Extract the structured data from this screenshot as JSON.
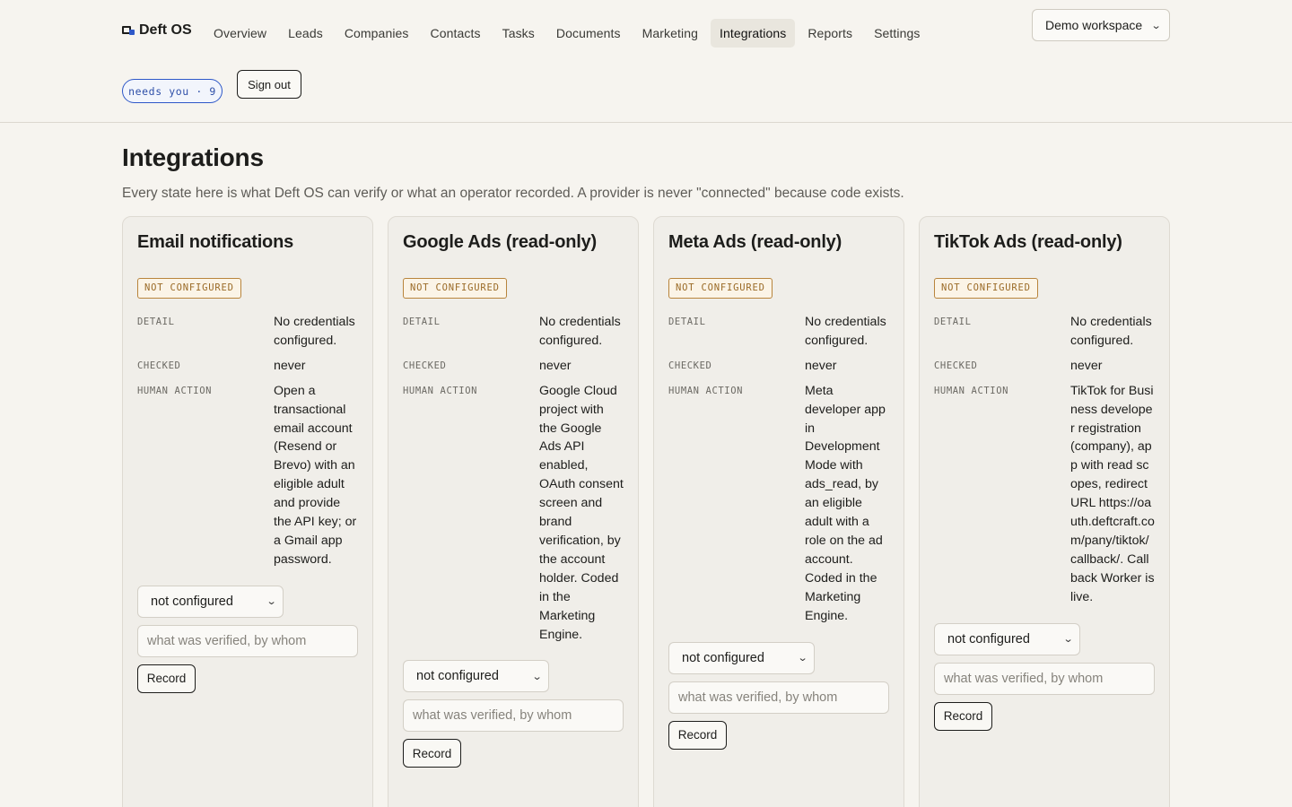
{
  "brand": {
    "name": "Deft OS"
  },
  "nav": {
    "items": [
      {
        "label": "Overview"
      },
      {
        "label": "Leads"
      },
      {
        "label": "Companies"
      },
      {
        "label": "Contacts"
      },
      {
        "label": "Tasks"
      },
      {
        "label": "Documents"
      },
      {
        "label": "Marketing"
      },
      {
        "label": "Integrations",
        "active": true
      },
      {
        "label": "Reports"
      },
      {
        "label": "Settings"
      }
    ]
  },
  "workspace": {
    "selected": "Demo workspace"
  },
  "needs_you": "needs you · 9",
  "sign_out_label": "Sign out",
  "page": {
    "title": "Integrations",
    "subtitle": "Every state here is what Deft OS can verify or what an operator recorded. A provider is never \"connected\" because code exists."
  },
  "labels": {
    "detail": "DETAIL",
    "checked": "CHECKED",
    "human_action": "HUMAN ACTION"
  },
  "cards": [
    {
      "title": "Email notifications",
      "status": "NOT CONFIGURED",
      "detail": "No credentials configured.",
      "checked": "never",
      "human_action": "Open a transactional email account (Resend or Brevo) with an eligible adult and provide the API key; or a Gmail app password.",
      "state_select": "not configured",
      "note_placeholder": "what was verified, by whom",
      "record_label": "Record"
    },
    {
      "title": "Google Ads (read-only)",
      "status": "NOT CONFIGURED",
      "detail": "No credentials configured.",
      "checked": "never",
      "human_action": "Google Cloud project with the Google Ads API enabled, OAuth consent screen and brand verification, by the account holder. Coded in the Marketing Engine.",
      "state_select": "not configured",
      "note_placeholder": "what was verified, by whom",
      "record_label": "Record"
    },
    {
      "title": "Meta Ads (read-only)",
      "status": "NOT CONFIGURED",
      "detail": "No credentials configured.",
      "checked": "never",
      "human_action": "Meta developer app in Development Mode with ads_read, by an eligible adult with a role on the ad account. Coded in the Marketing Engine.",
      "state_select": "not configured",
      "note_placeholder": "what was verified, by whom",
      "record_label": "Record"
    },
    {
      "title": "TikTok Ads (read-only)",
      "status": "NOT CONFIGURED",
      "detail": "No credentials configured.",
      "checked": "never",
      "human_action": "TikTok for Business developer registration (company), app with read scopes, redirect URL https://oauth.deftcraft.com/pany/tiktok/callback/. Callback Worker is live.",
      "state_select": "not configured",
      "note_placeholder": "what was verified, by whom",
      "record_label": "Record"
    }
  ],
  "colors": {
    "accent": "#2e58c8",
    "badge_border": "#b8843c",
    "badge_text": "#9a6a26",
    "background": "#f6f4ef"
  }
}
